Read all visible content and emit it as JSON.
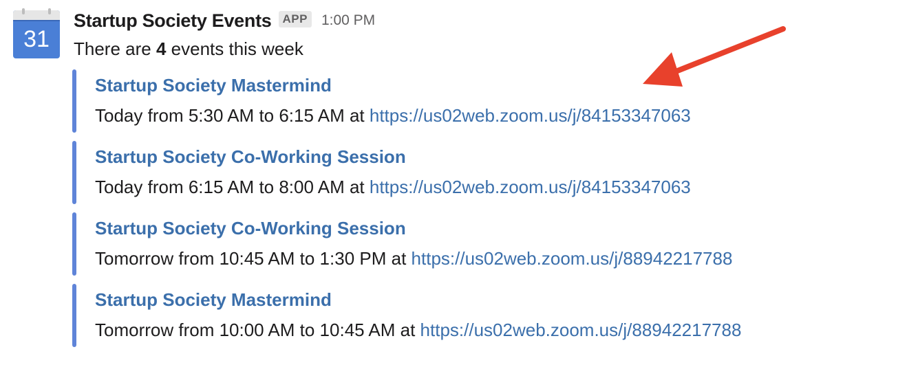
{
  "message": {
    "sender": "Startup Society Events",
    "badge": "APP",
    "timestamp": "1:00 PM",
    "avatar_day": "31",
    "summary_prefix": "There are ",
    "summary_count": "4",
    "summary_suffix": " events this week"
  },
  "events": [
    {
      "title": "Startup Society Mastermind",
      "when": "Today from 5:30 AM to 6:15 AM at ",
      "link": "https://us02web.zoom.us/j/84153347063"
    },
    {
      "title": "Startup Society Co-Working Session",
      "when": "Today from 6:15 AM to 8:00 AM at ",
      "link": "https://us02web.zoom.us/j/84153347063"
    },
    {
      "title": "Startup Society Co-Working Session",
      "when": "Tomorrow from 10:45 AM to 1:30 PM at ",
      "link": "https://us02web.zoom.us/j/88942217788"
    },
    {
      "title": "Startup Society Mastermind",
      "when": "Tomorrow from 10:00 AM to 10:45 AM at ",
      "link": "https://us02web.zoom.us/j/88942217788"
    }
  ],
  "colors": {
    "link": "#3b6fab",
    "attachment_bar": "#5f84d8",
    "calendar_blue": "#4a7fd6",
    "annotation_arrow": "#e8412c"
  },
  "icons": {
    "avatar": "calendar-icon",
    "annotation": "arrow-icon"
  }
}
